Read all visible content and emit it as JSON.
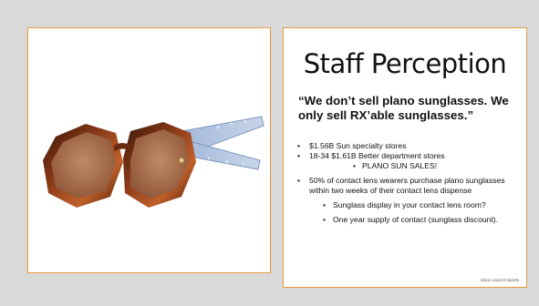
{
  "slide": {
    "title": "Staff Perception",
    "quote": "“We don’t sell plano sunglasses. We only sell RX’able sunglasses.”",
    "bullets": {
      "b1": "$1.56B Sun specialty stores",
      "b2": "18-34 $1.61B Better department stores",
      "b2_sub": "PLANO SUN SALES!",
      "b3": "50% of contact lens wearers purchase plano sunglasses within two weeks of their contact lens dispense",
      "b3_sub1": "Sunglass display in your contact lens room?",
      "b3_sub2": "One year supply of contact (sunglass discount)."
    },
    "footnote": "vision council reports"
  },
  "colors": {
    "background": "#d9d9d9",
    "panel_border": "#e59a3a",
    "frame_tortoise": "#7a2e12",
    "lens": "#b07a5a",
    "temple": "#a9bedb"
  },
  "image": {
    "subject": "sunglasses-photo"
  }
}
